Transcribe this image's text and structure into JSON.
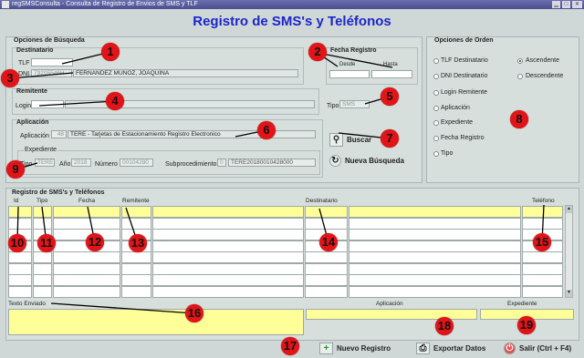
{
  "window": {
    "title": "regSMSConsulta - Consulta de Registro de Envios de SMS y TLF"
  },
  "page_title": "Registro de SMS's y Teléfonos",
  "search": {
    "title": "Opciones de Búsqueda",
    "destinatario": {
      "title": "Destinatario",
      "tlf_label": "TLF",
      "tlf_value": "",
      "dni_label": "DNI",
      "dni_value": "79205546H",
      "name_value": "FERNANDEZ MUÑOZ, JOAQUINA"
    },
    "fecha": {
      "title": "Fecha Registro",
      "desde_label": "Desde",
      "hasta_label": "Hasta",
      "desde_value": "",
      "hasta_value": ""
    },
    "remitente": {
      "title": "Remitente",
      "login_label": "Login",
      "login_value": ""
    },
    "tipo": {
      "label": "Tipo",
      "value": "SMS"
    },
    "aplicacion": {
      "title": "Aplicación",
      "app_label": "Aplicación",
      "app_code": "48",
      "app_text": "TERE - Tarjetas de Estacionamiento Registro Electronico"
    },
    "expediente": {
      "title": "Expediente",
      "tipo_label": "Tipo",
      "tipo_value": "TERE",
      "ano_label": "Año",
      "ano_value": "2018",
      "numero_label": "Número",
      "numero_value": "00104280",
      "sub_label": "Subprocedimiento",
      "sub_value": "0",
      "sub_text": "TERE20180010428000"
    },
    "buscar_label": "Buscar",
    "nueva_label": "Nueva Búsqueda"
  },
  "order": {
    "title": "Opciones de Orden",
    "options": [
      "TLF Destinatario",
      "DNI Destinatario",
      "Login Remitente",
      "Aplicación",
      "Expediente",
      "Fecha Registro",
      "Tipo"
    ],
    "ascendente": "Ascendente",
    "descendente": "Descendente"
  },
  "grid": {
    "title": "Registro de SMS's y Teléfonos",
    "headers": {
      "id": "Id",
      "tipo": "Tipo",
      "fecha": "Fecha",
      "remitente": "Remitente",
      "destinatario": "Destinatario",
      "telefono": "Teléfono"
    },
    "footer": {
      "texto": "Texto Enviado",
      "aplicacion": "Aplicación",
      "expediente": "Expediente"
    }
  },
  "actions": {
    "nuevo": "Nuevo Registro",
    "exportar": "Exportar Datos",
    "salir": "Salir (Ctrl + F4)"
  },
  "markers": [
    "1",
    "2",
    "3",
    "4",
    "5",
    "6",
    "7",
    "8",
    "9",
    "10",
    "11",
    "12",
    "13",
    "14",
    "15",
    "16",
    "17",
    "18",
    "19"
  ],
  "colors": {
    "title_blue": "#1e25cc",
    "highlight_yellow": "#ffff99",
    "marker_red": "#e21418",
    "background": "#cfd8d6"
  }
}
